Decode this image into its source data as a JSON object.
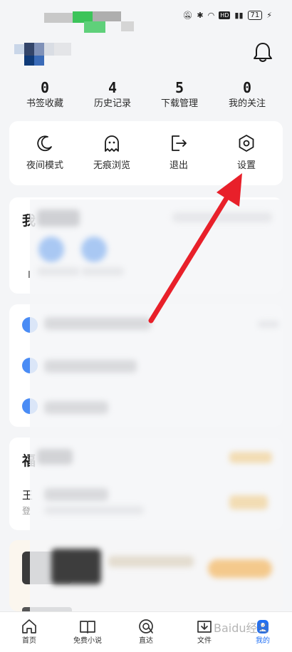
{
  "status_bar": {
    "battery_level": "71",
    "hd_badge": "HD"
  },
  "stats": [
    {
      "count": "0",
      "label": "书签收藏"
    },
    {
      "count": "4",
      "label": "历史记录"
    },
    {
      "count": "5",
      "label": "下载管理"
    },
    {
      "count": "0",
      "label": "我的关注"
    }
  ],
  "tools": [
    {
      "label": "夜间模式",
      "icon": "moon-icon"
    },
    {
      "label": "无痕浏览",
      "icon": "ghost-icon"
    },
    {
      "label": "退出",
      "icon": "exit-icon"
    },
    {
      "label": "设置",
      "icon": "settings-icon"
    }
  ],
  "partial_labels": {
    "section_a": "我",
    "row_a_first": "I",
    "section_b": "福",
    "row_b_title": "王",
    "row_b_sub": "登"
  },
  "nav": [
    {
      "label": "首页",
      "icon": "home-icon"
    },
    {
      "label": "免费小说",
      "icon": "book-icon"
    },
    {
      "label": "直达",
      "icon": "direct-icon"
    },
    {
      "label": "文件",
      "icon": "file-icon"
    },
    {
      "label": "我的",
      "icon": "profile-icon"
    }
  ],
  "annotation": {
    "arrow_color": "#e8202a",
    "accent_color": "#1f6ff5"
  },
  "watermark": "Baidu经验"
}
